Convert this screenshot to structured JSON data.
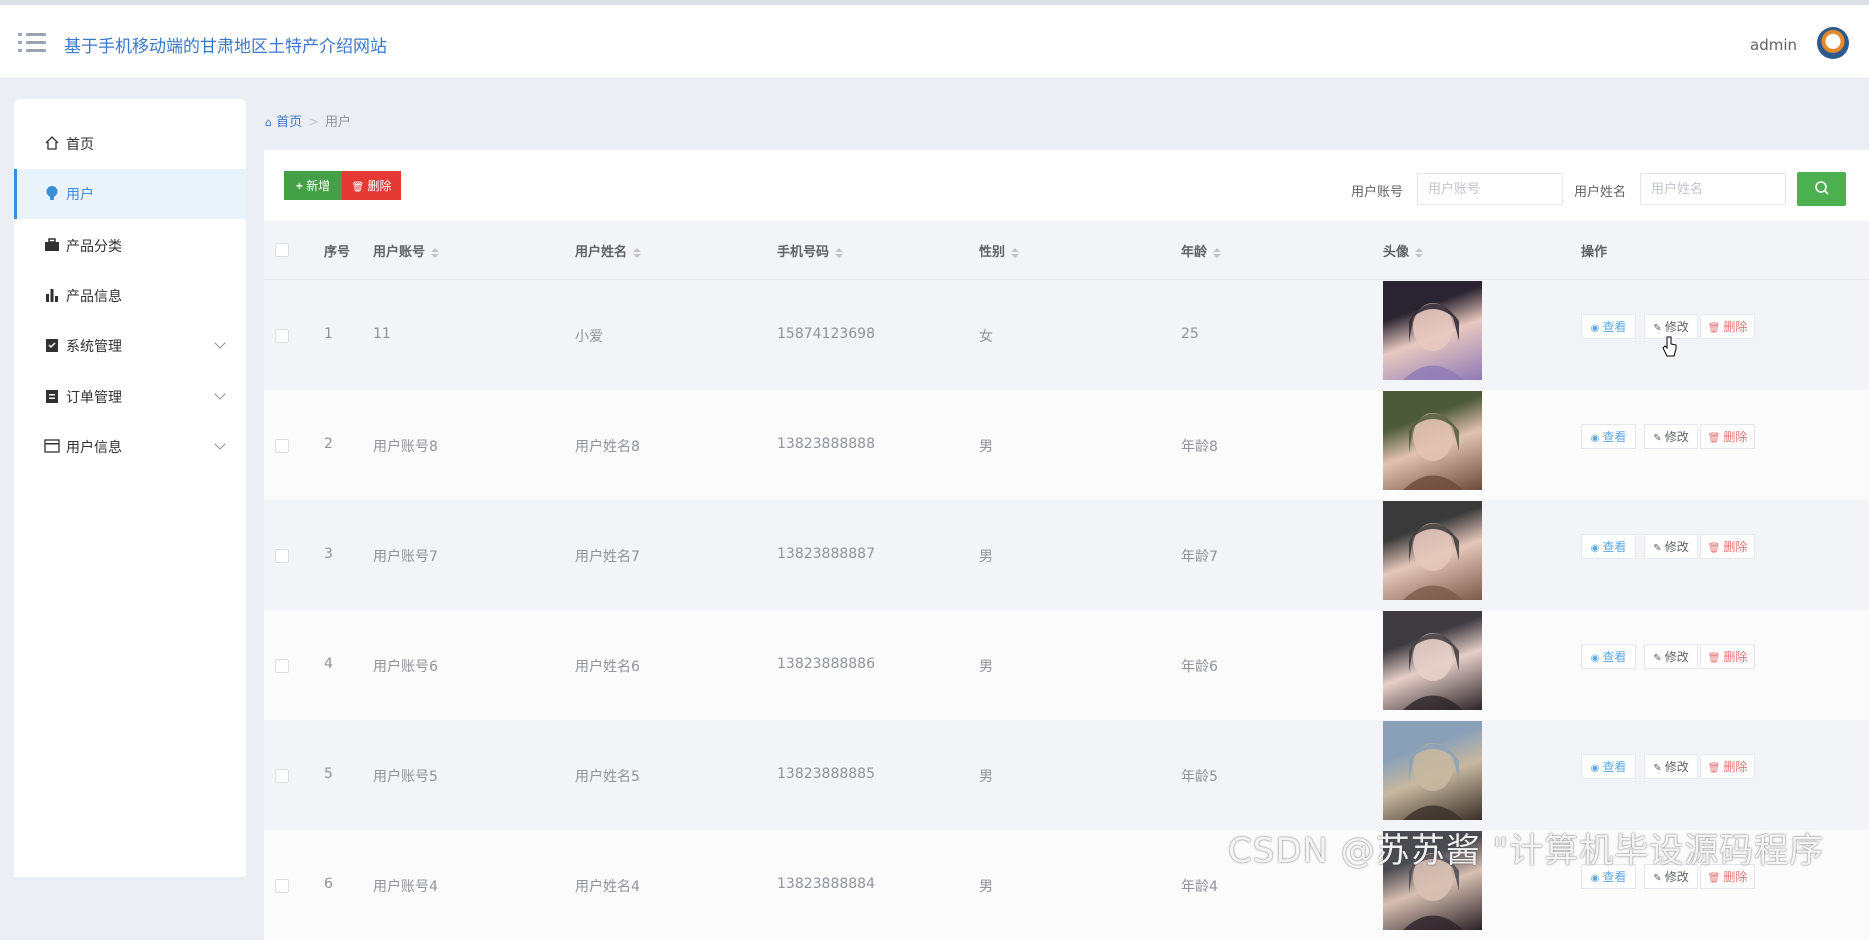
{
  "app": {
    "title": "基于手机移动端的甘肃地区土特产介绍网站",
    "user": "admin"
  },
  "sidebar": {
    "items": [
      {
        "label": "首页",
        "icon": "home-icon"
      },
      {
        "label": "用户",
        "icon": "bulb-icon",
        "active": true
      },
      {
        "label": "产品分类",
        "icon": "briefcase-icon"
      },
      {
        "label": "产品信息",
        "icon": "bar-chart-icon"
      },
      {
        "label": "系统管理",
        "icon": "clipboard-check-icon",
        "expandable": true
      },
      {
        "label": "订单管理",
        "icon": "clipboard-icon",
        "expandable": true
      },
      {
        "label": "用户信息",
        "icon": "card-icon",
        "expandable": true
      }
    ]
  },
  "breadcrumb": {
    "home": "首页",
    "separator": ">",
    "current": "用户"
  },
  "toolbar": {
    "add_label": "新增",
    "delete_label": "删除"
  },
  "search": {
    "account_label": "用户账号",
    "account_placeholder": "用户账号",
    "name_label": "用户姓名",
    "name_placeholder": "用户姓名"
  },
  "table": {
    "columns": [
      "序号",
      "用户账号",
      "用户姓名",
      "手机号码",
      "性别",
      "年龄",
      "头像",
      "操作"
    ],
    "actions": {
      "view": "查看",
      "edit": "修改",
      "remove": "删除"
    },
    "rows": [
      {
        "index": "1",
        "account": "11",
        "name": "小爱",
        "phone": "15874123698",
        "gender": "女",
        "age": "25"
      },
      {
        "index": "2",
        "account": "用户账号8",
        "name": "用户姓名8",
        "phone": "13823888888",
        "gender": "男",
        "age": "年龄8"
      },
      {
        "index": "3",
        "account": "用户账号7",
        "name": "用户姓名7",
        "phone": "13823888887",
        "gender": "男",
        "age": "年龄7"
      },
      {
        "index": "4",
        "account": "用户账号6",
        "name": "用户姓名6",
        "phone": "13823888886",
        "gender": "男",
        "age": "年龄6"
      },
      {
        "index": "5",
        "account": "用户账号5",
        "name": "用户姓名5",
        "phone": "13823888885",
        "gender": "男",
        "age": "年龄5"
      },
      {
        "index": "6",
        "account": "用户账号4",
        "name": "用户姓名4",
        "phone": "13823888884",
        "gender": "男",
        "age": "年龄4"
      }
    ]
  },
  "watermark": "CSDN @苏苏酱 \"计算机毕设源码程序",
  "colors": {
    "accent": "#3c78c8",
    "add": "#43a047",
    "delete": "#e53935",
    "search": "#4caf50"
  }
}
